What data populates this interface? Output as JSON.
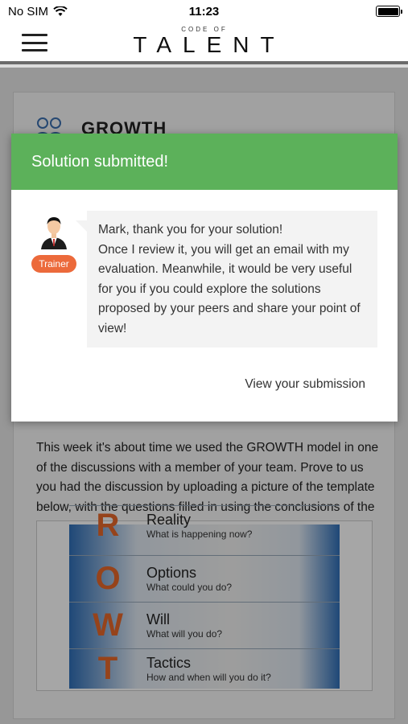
{
  "status_bar": {
    "carrier": "No SIM",
    "time": "11:23"
  },
  "header": {
    "logo_small": "CODE OF",
    "logo_big": "TALENT"
  },
  "background": {
    "section_title": "GROWTH",
    "body_text": "This week it's about time we used the GROWTH model in one of the discussions with a member of your team. Prove to us you had the discussion by uploading a picture of the template below, with the questions filled in using the conclusions of the discussion.",
    "grow_rows": [
      {
        "letter": "R",
        "title": "Reality",
        "sub": "What is happening now?"
      },
      {
        "letter": "O",
        "title": "Options",
        "sub": "What could you do?"
      },
      {
        "letter": "W",
        "title": "Will",
        "sub": "What will you do?"
      },
      {
        "letter": "T",
        "title": "Tactics",
        "sub": "How and when will you do it?"
      }
    ]
  },
  "modal": {
    "title": "Solution submitted!",
    "trainer_badge": "Trainer",
    "message_line1": "Mark, thank you for your solution!",
    "message_body": "Once I review it, you will get an email with my evaluation. Meanwhile, it would be very useful for you if you could explore the solutions proposed by your peers and share your point of view!",
    "view_link": "View your submission"
  },
  "colors": {
    "modal_header": "#5cb15a",
    "trainer_badge": "#ec6a3b",
    "grow_letter": "#e6682a"
  }
}
